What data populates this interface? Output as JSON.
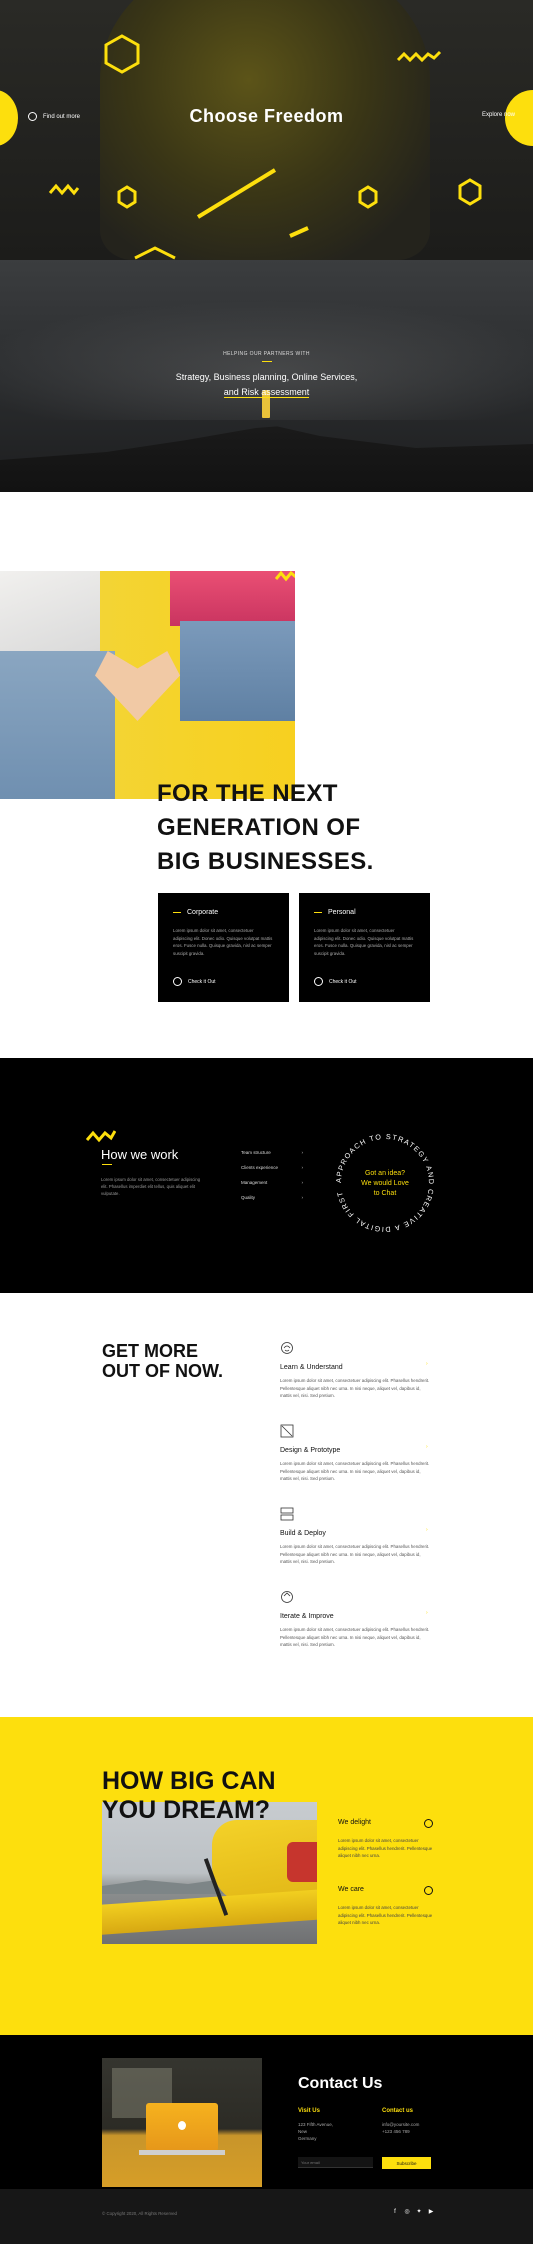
{
  "hero": {
    "title": "Choose Freedom",
    "left_link": "Find out more",
    "right_link": "Explore now"
  },
  "banner": {
    "kicker": "HELPING OUR PARTNERS WITH",
    "line1": "Strategy, Business planning, Online Services,",
    "line2": "and Risk assessment"
  },
  "nextgen": {
    "heading_l1": "FOR THE NEXT",
    "heading_l2": "GENERATION OF",
    "heading_l3": "BIG BUSINESSES.",
    "cards": [
      {
        "title": "Corporate",
        "text": "Lorem ipsum dolor sit amet, consectetuer adipiscing elit. Donec odio. Quisque volutpat mattis eros. Fusce nulla. Quisque gravida, nisl ac semper suscipit gravida.",
        "cta": "Check it Out"
      },
      {
        "title": "Personal",
        "text": "Lorem ipsum dolor sit amet, consectetuer adipiscing elit. Donec odio. Quisque volutpat mattis eros. Fusce nulla. Quisque gravida, nisl ac semper suscipit gravida.",
        "cta": "Check it Out"
      }
    ]
  },
  "how": {
    "title": "How we work",
    "text": "Lorem ipsum dolor sit amet, consectetuer adipiscing elit. Phasellus imperdiet elit tellus, quis aliquet elit vulputate.",
    "list": [
      "Team structure",
      "Clients experience",
      "Management",
      "Quality"
    ],
    "chat_l1": "Got an idea?",
    "chat_l2": "We would Love",
    "chat_l3": "to Chat",
    "ring_text": "APPROACH TO STRATEGY AND CREATIVE A DIGITAL FIRST"
  },
  "getmore": {
    "heading_l1": "GET MORE",
    "heading_l2": "OUT OF NOW.",
    "items": [
      {
        "icon": "brain-icon",
        "title": "Learn & Understand",
        "text": "Lorem ipsum dolor sit amet, consectetuer adipiscing elit. Phasellus hendrerit. Pellentesque aliquet nibh nec urna. In nisi neque, aliquet vel, dapibus id, mattis vel, nisi. Sed pretium."
      },
      {
        "icon": "pencil-ruler-icon",
        "title": "Design & Prototype",
        "text": "Lorem ipsum dolor sit amet, consectetuer adipiscing elit. Phasellus hendrerit. Pellentesque aliquet nibh nec urna. In nisi neque, aliquet vel, dapibus id, mattis vel, nisi. Sed pretium."
      },
      {
        "icon": "server-icon",
        "title": "Build & Deploy",
        "text": "Lorem ipsum dolor sit amet, consectetuer adipiscing elit. Phasellus hendrerit. Pellentesque aliquet nibh nec urna. In nisi neque, aliquet vel, dapibus id, mattis vel, nisi. Sed pretium."
      },
      {
        "icon": "cycle-icon",
        "title": "Iterate & Improve",
        "text": "Lorem ipsum dolor sit amet, consectetuer adipiscing elit. Phasellus hendrerit. Pellentesque aliquet nibh nec urna. In nisi neque, aliquet vel, dapibus id, mattis vel, nisi. Sed pretium."
      }
    ]
  },
  "howbig": {
    "heading_l1": "HOW BIG CAN",
    "heading_l2": "YOU DREAM?",
    "items": [
      {
        "title": "We delight",
        "text": "Lorem ipsum dolor sit amet, consectetuer adipiscing elit. Phasellus hendrerit. Pellentesque aliquet nibh nec urna."
      },
      {
        "title": "We care",
        "text": "Lorem ipsum dolor sit amet, consectetuer adipiscing elit. Phasellus hendrerit. Pellentesque aliquet nibh nec urna."
      }
    ]
  },
  "contact": {
    "title": "Contact Us",
    "visit_title": "Visit Us",
    "visit_l1": "123 Fifth Avenue,",
    "visit_l2": "New",
    "visit_l3": "Germany",
    "contact_title": "Contact us",
    "contact_l1": "info@yoursite.com",
    "contact_l2": "+123 456 789",
    "email_placeholder": "Your email",
    "subscribe": "Subscribe"
  },
  "footer": {
    "copyright": "© Copyright 2020, All Rights Reserved",
    "social": [
      "facebook-icon",
      "instagram-icon",
      "twitter-icon",
      "youtube-icon"
    ]
  },
  "colors": {
    "accent": "#fddf0d",
    "dark": "#000000",
    "text": "#111111"
  }
}
